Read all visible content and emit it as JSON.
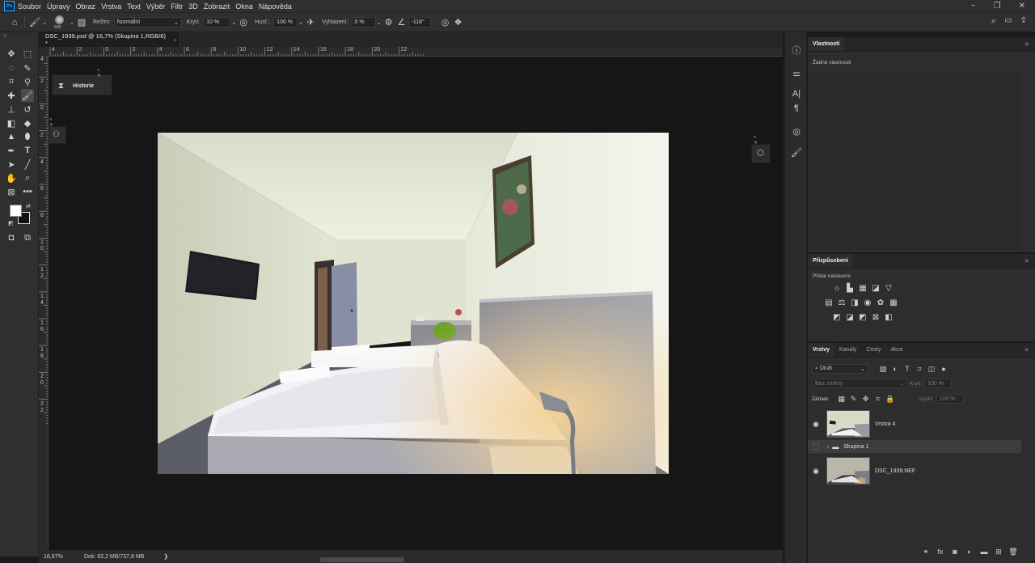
{
  "app": {
    "logo": "Ps"
  },
  "menu": [
    "Soubor",
    "Úpravy",
    "Obraz",
    "Vrstva",
    "Text",
    "Výběr",
    "Filtr",
    "3D",
    "Zobrazit",
    "Okna",
    "Nápověda"
  ],
  "window_controls": {
    "minimize": "−",
    "restore": "❐",
    "close": "✕"
  },
  "options_bar": {
    "brush_size": "606",
    "mode_label": "Režim:",
    "mode_value": "Normální",
    "opacity_label": "Krytí:",
    "opacity_value": "10 %",
    "flow_label": "Husť.:",
    "flow_value": "100 %",
    "smoothing_label": "Vyhlazení:",
    "smoothing_value": "0 %",
    "angle_value": "-118°"
  },
  "document_tab": {
    "title": "DSC_1939.psd @ 16,7% (Skupina 1,RGB/8) *",
    "close": "×"
  },
  "ruler_h_ticks": [
    "4",
    "2",
    "0",
    "2",
    "4",
    "6",
    "8",
    "10",
    "12",
    "14",
    "16",
    "18",
    "20",
    "22"
  ],
  "ruler_v_ticks": [
    "4",
    "2",
    "0",
    "2",
    "4",
    "6",
    "8",
    "10",
    "12",
    "14",
    "16",
    "18",
    "20",
    "22"
  ],
  "mini_panels": {
    "history_label": "Historie"
  },
  "status_bar": {
    "zoom": "16,67%",
    "doc_info": "Dok: 62,2 MB/737,8 MB",
    "arrow": "❯"
  },
  "properties_panel": {
    "tab": "Vlastnosti",
    "empty_text": "Žádné vlastnosti"
  },
  "adjustments_panel": {
    "tab": "Přizpůsobení",
    "add_label": "Přidat nastavení"
  },
  "layers_panel": {
    "tabs": [
      "Vrstvy",
      "Kanály",
      "Cesty",
      "Akce"
    ],
    "filter_kind": "Druh",
    "blend_mode": "Bez změny",
    "opacity_label": "Krytí:",
    "opacity_value": "100 %",
    "lock_label": "Zámek:",
    "fill_label": "Výplň:",
    "fill_value": "100 %",
    "layers": [
      {
        "name": "Vrstva 4",
        "visible": true
      },
      {
        "name": "Skupina 1",
        "visible": false,
        "group": true
      },
      {
        "name": "DSC_1939.NEF",
        "visible": true
      }
    ]
  },
  "colors": {
    "accent": "#31a8ff",
    "panel": "#2d2d2d",
    "canvas": "#161616"
  }
}
